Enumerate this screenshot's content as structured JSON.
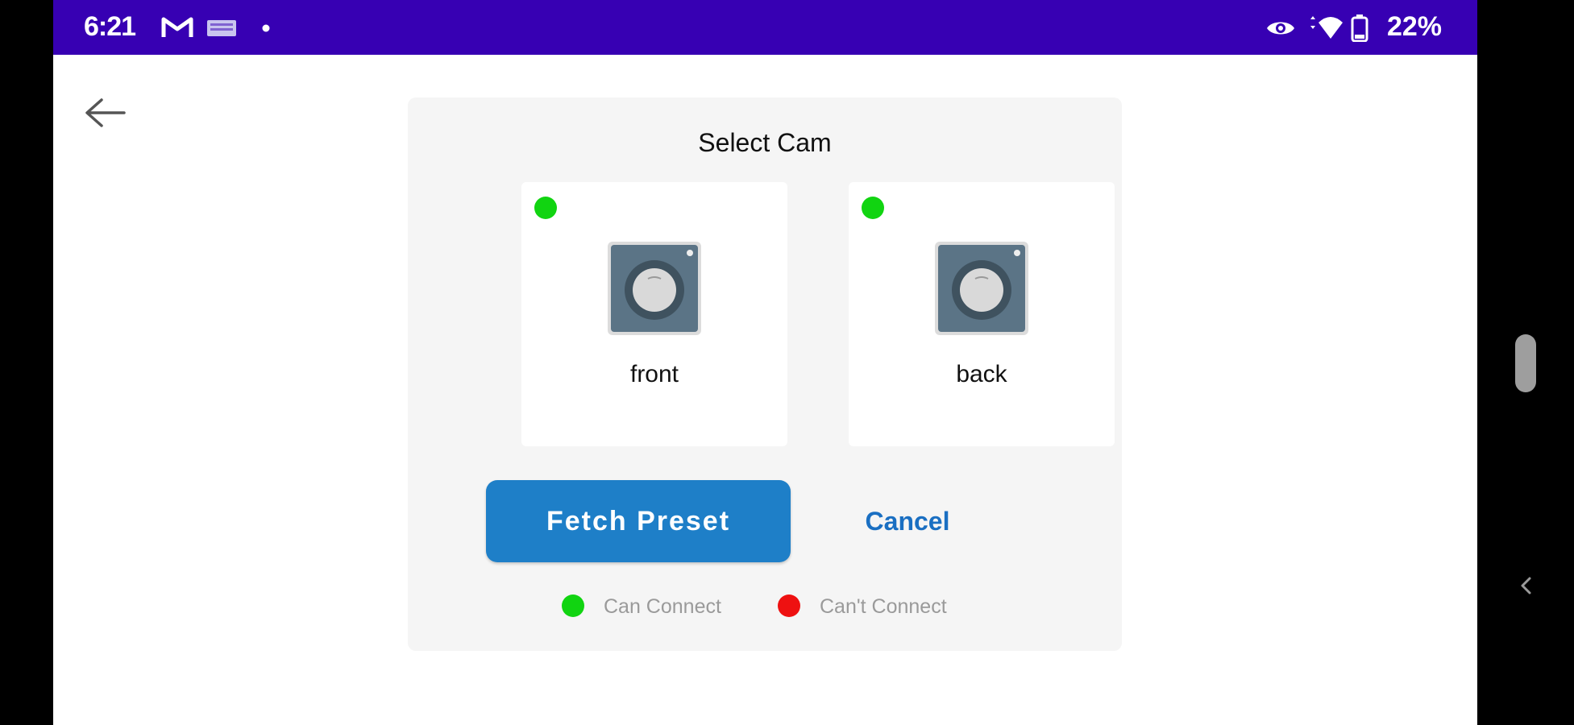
{
  "status_bar": {
    "time": "6:21",
    "battery_percent": "22%",
    "left_icons": [
      "gmail-icon",
      "keyboard-icon",
      "dot-icon"
    ],
    "right_icons": [
      "eye-icon",
      "wifi-icon",
      "battery-icon"
    ]
  },
  "colors": {
    "status_bar": "#3700b3",
    "primary_button": "#1e7fc8",
    "link": "#1a6fc2",
    "can_connect": "#11d411",
    "cant_connect": "#ee1111"
  },
  "dialog": {
    "title": "Select Cam",
    "cameras": [
      {
        "label": "front",
        "status": "can_connect",
        "icon": "camera-icon"
      },
      {
        "label": "back",
        "status": "can_connect",
        "icon": "camera-icon"
      }
    ],
    "primary_button": "Fetch Preset",
    "secondary_button": "Cancel",
    "legend": [
      {
        "label": "Can Connect",
        "color": "#11d411"
      },
      {
        "label": "Can't Connect",
        "color": "#ee1111"
      }
    ]
  }
}
